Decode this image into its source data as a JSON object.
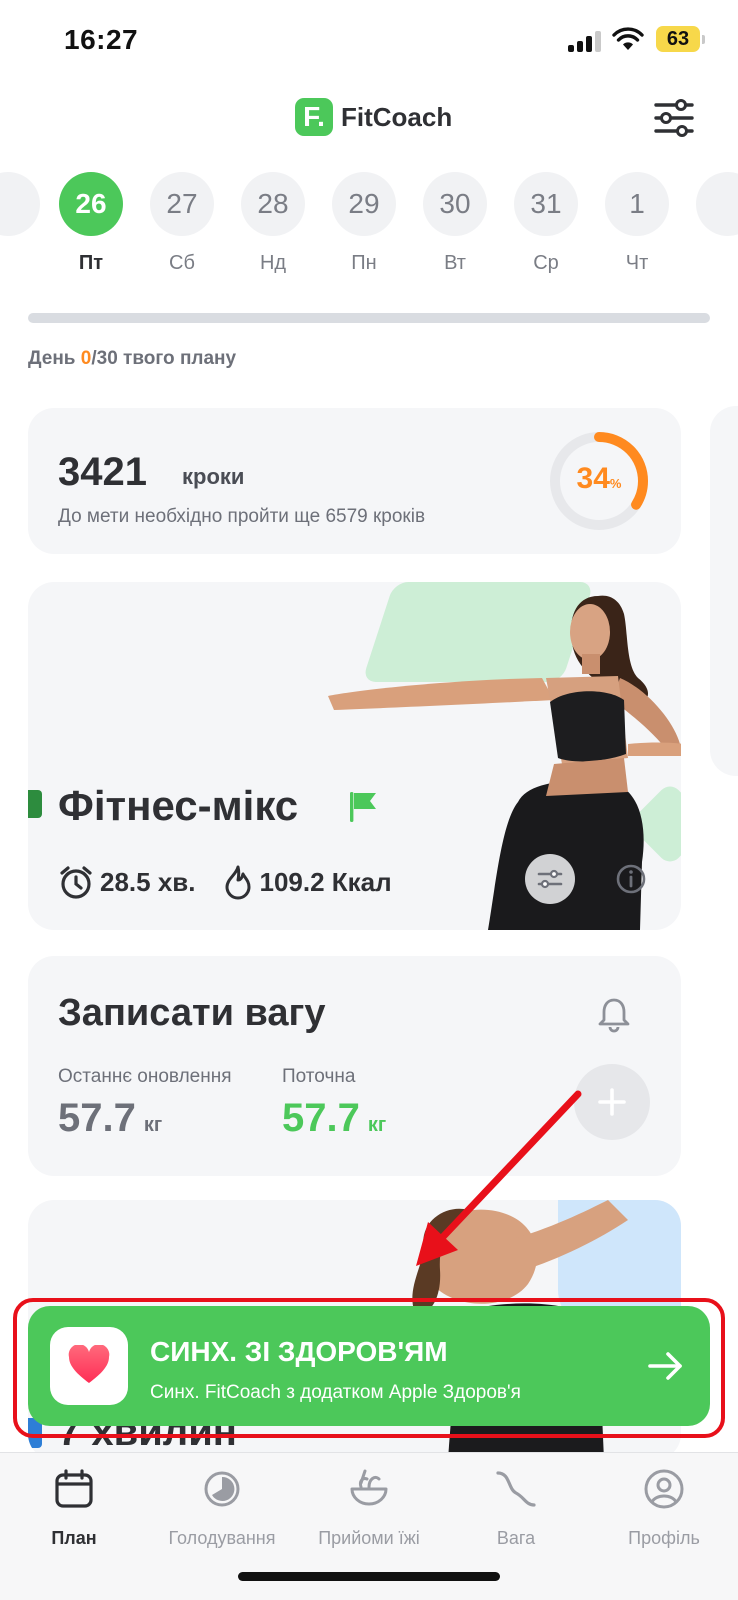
{
  "status_bar": {
    "time": "16:27",
    "battery": "63"
  },
  "header": {
    "logo_mark": "F.",
    "app_name": "FitCoach",
    "filter_icon": "sliders-icon"
  },
  "dates": [
    {
      "num": "",
      "dow": ""
    },
    {
      "num": "26",
      "dow": "Пт",
      "active": true
    },
    {
      "num": "27",
      "dow": "Сб"
    },
    {
      "num": "28",
      "dow": "Нд"
    },
    {
      "num": "29",
      "dow": "Пн"
    },
    {
      "num": "30",
      "dow": "Вт"
    },
    {
      "num": "31",
      "dow": "Ср"
    },
    {
      "num": "1",
      "dow": "Чт"
    },
    {
      "num": "",
      "dow": ""
    }
  ],
  "plan": {
    "prefix": "День ",
    "current": "0",
    "suffix": "/30 твого плану"
  },
  "steps": {
    "count": "3421",
    "unit": "кроки",
    "goal": "До мети необхідно пройти ще 6579 кроків",
    "percent": "34",
    "percent_sign": "%",
    "progress": 0.34,
    "ring_color": "#ff8a1f"
  },
  "workout": {
    "title": "Фітнес-мікс",
    "duration": "28.5 хв.",
    "calories": "109.2 Ккал"
  },
  "weight": {
    "title": "Записати вагу",
    "last_label": "Останнє оновлення",
    "last_value": "57.7",
    "last_unit": "кг",
    "current_label": "Поточна",
    "current_value": "57.7",
    "current_unit": "кг"
  },
  "promo": {
    "title": "7 хвилин"
  },
  "sync_banner": {
    "title": "СИНХ. ЗІ ЗДОРОВ'ЯМ",
    "subtitle": "Синх. FitCoach з додатком Apple Здоров'я"
  },
  "tabs": [
    {
      "label": "План",
      "icon": "calendar-icon",
      "active": true
    },
    {
      "label": "Голодування",
      "icon": "timer-icon"
    },
    {
      "label": "Прийоми їжі",
      "icon": "bowl-icon"
    },
    {
      "label": "Вага",
      "icon": "weight-curve-icon"
    },
    {
      "label": "Профіль",
      "icon": "profile-icon"
    }
  ],
  "colors": {
    "accent": "#4cc85a",
    "orange": "#ff8a1f",
    "annotation": "#e8101a"
  }
}
